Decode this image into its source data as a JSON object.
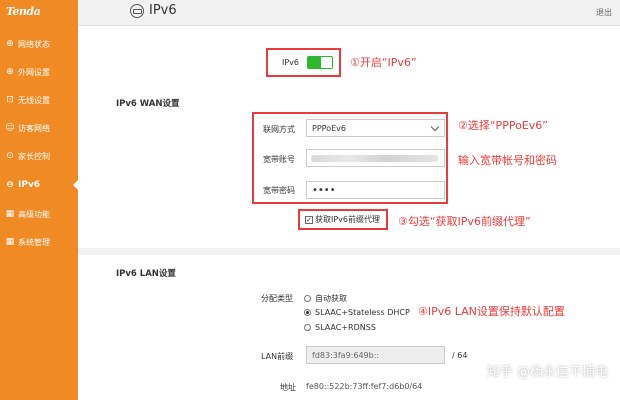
{
  "brand": {
    "logo_text": "Tenda",
    "accent": "#f08a24",
    "highlight": "#e83b3b",
    "toggle_on": "#2eb82e"
  },
  "sidebar": {
    "items": [
      {
        "label": "网络状态",
        "icon": "globe-icon"
      },
      {
        "label": "外网设置",
        "icon": "globe-icon"
      },
      {
        "label": "无线设置",
        "icon": "wifi-icon"
      },
      {
        "label": "访客网络",
        "icon": "guest-icon"
      },
      {
        "label": "家长控制",
        "icon": "parental-icon"
      },
      {
        "label": "IPv6",
        "icon": "ipv6-icon",
        "active": true
      },
      {
        "label": "高级功能",
        "icon": "grid-icon"
      },
      {
        "label": "系统管理",
        "icon": "settings-icon"
      }
    ]
  },
  "header": {
    "title": "IPv6",
    "logout": "退出"
  },
  "ipv6_toggle": {
    "label": "IPv6",
    "enabled": true
  },
  "wan": {
    "title": "IPv6 WAN设置",
    "connection_type_label": "联网方式",
    "connection_type_value": "PPPoEv6",
    "account_label": "宽带账号",
    "password_label": "宽带密码",
    "password_value": "••••",
    "prefix_delegation_label": "获取IPv6前缀代理",
    "prefix_delegation_checked": true
  },
  "lan": {
    "title": "IPv6 LAN设置",
    "assignment_label": "分配类型",
    "options": [
      "自动获取",
      "SLAAC+Stateless DHCP",
      "SLAAC+RDNSS"
    ],
    "selected_option": 1,
    "prefix_label": "LAN前缀",
    "prefix_value": "fd83:3fa9:649b::",
    "prefix_suffix": "/ 64",
    "address_label": "地址",
    "address_value": "fe80::522b:73ff:fef7:d6b0/64"
  },
  "annotations": {
    "step1": "①开启“IPv6”",
    "step2": "②选择“PPPoEv6”",
    "step2b": "输入宽带帐号和密码",
    "step3": "③勾选“获取IPv6前缀代理”",
    "step4": "④IPv6 LAN设置保持默认配置"
  },
  "watermark": "知乎 @杨永信不插电"
}
